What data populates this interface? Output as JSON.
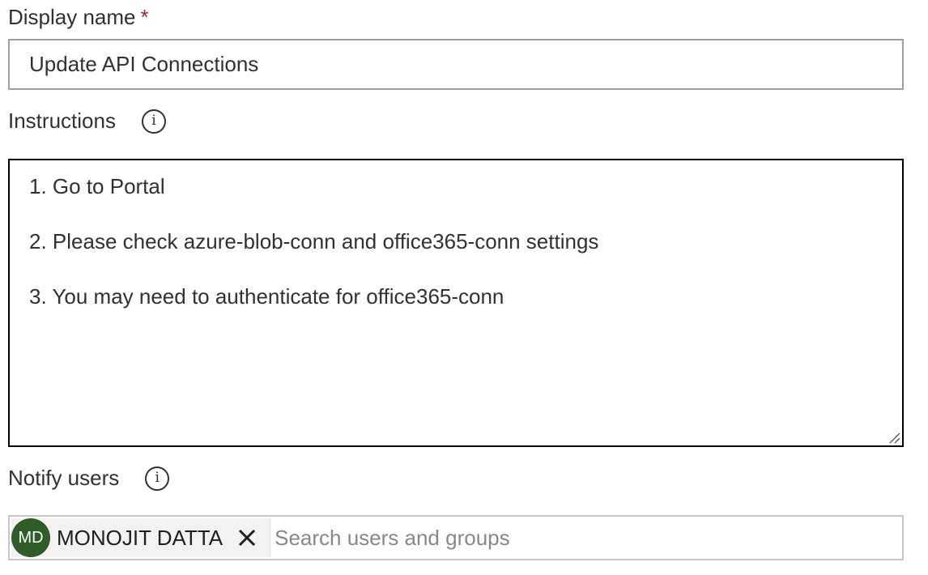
{
  "display_name": {
    "label": "Display name",
    "required_marker": "*",
    "value": "Update API Connections"
  },
  "instructions": {
    "label": "Instructions",
    "info_icon": "info-icon",
    "lines": [
      "1. Go to Portal",
      "2. Please check azure-blob-conn and office365-conn settings",
      "3. You may need to authenticate for office365-conn"
    ]
  },
  "notify_users": {
    "label": "Notify users",
    "info_icon": "info-icon",
    "selected": [
      {
        "initials": "MD",
        "name": "MONOJIT DATTA",
        "avatar_color": "#2e5d27"
      }
    ],
    "search_placeholder": "Search users and groups",
    "remove_icon": "close-icon"
  },
  "colors": {
    "required": "#a4262c",
    "text": "#323130",
    "input_border": "#a19f9d",
    "focused_border": "#000000",
    "placeholder": "#8a8886"
  }
}
